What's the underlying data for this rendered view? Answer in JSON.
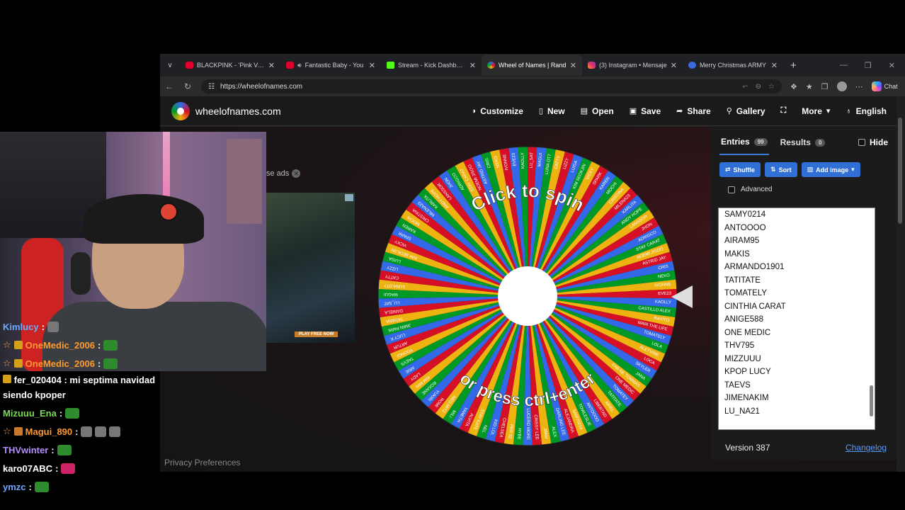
{
  "browser": {
    "tabs": [
      {
        "title": "BLACKPINK - 'Pink Vend",
        "icon": "youtube",
        "active": false
      },
      {
        "title": "Fantastic Baby - You",
        "icon": "youtube",
        "active": false
      },
      {
        "title": "Stream - Kick Dashboard",
        "icon": "kick",
        "active": false
      },
      {
        "title": "Wheel of Names | Rand",
        "icon": "wheelofnames",
        "active": true
      },
      {
        "title": "(3) Instagram • Mensaje",
        "icon": "instagram",
        "active": false
      },
      {
        "title": "Merry Christmas ARMY",
        "icon": "army",
        "active": false
      }
    ],
    "url": "https://wheelofnames.com",
    "chat_label": "Chat"
  },
  "site": {
    "brand": "wheelofnames.com",
    "menu": [
      {
        "label": "Customize",
        "icon": "palette-icon"
      },
      {
        "label": "New",
        "icon": "file-icon"
      },
      {
        "label": "Open",
        "icon": "folder-icon"
      },
      {
        "label": "Save",
        "icon": "save-icon"
      },
      {
        "label": "Share",
        "icon": "share-icon"
      },
      {
        "label": "Gallery",
        "icon": "search-icon"
      },
      {
        "label": "",
        "icon": "fullscreen-icon"
      },
      {
        "label": "More",
        "icon": "chevron-down-icon"
      },
      {
        "label": "English",
        "icon": "globe-icon"
      }
    ]
  },
  "ad": {
    "label": "se ads",
    "cta": "PLAY FREE NOW"
  },
  "privacy": "Privacy Preferences",
  "wheel": {
    "top_text": "Click to spin",
    "bottom_text": "or press ctrl+enter",
    "segment_colors": [
      "#d50f25",
      "#3369e8",
      "#009925",
      "#eeb211"
    ],
    "segment_count": 99,
    "labels": [
      "LU_SAT",
      "MAGUI",
      "LUNA OT7",
      "CATTY",
      "LIZZY",
      "LUISA",
      "KIM SEOKJIN",
      "VICKY",
      "SPARK",
      "KAREN",
      "MOCHI",
      "CRISTINA",
      "MILENA23",
      "KARLITA",
      "ANDY HOPE",
      "LANSSOR",
      "JHON",
      "ADRIGCO",
      "STAY CARAT",
      "NOEMI JISOO",
      "ASTRID JAY",
      "CRIS",
      "NEKO",
      "IVONNE",
      "EVE23",
      "KAOLLY",
      "CASTILLO ALEX",
      "RAYITO",
      "MARI THE LIFE",
      "TOMATELY",
      "LOLA",
      "ALETVINE",
      "LOCA",
      "SKYLER",
      "JANA",
      "FAB NE TOMMAS",
      "ONE MEDIC",
      "TOMATEY",
      "TATITATE",
      "ARIEL",
      "LIBERTAD",
      "ANTOOOO",
      "TOWLESLIE",
      "SAMY0214",
      "ALEJANDRA",
      "DARLING LEE",
      "ALEX",
      "JIMAI",
      "CRISSY LEE",
      "LUCERO MORE",
      "HYBE",
      "PER 02",
      "CHELSEA",
      "KIO LOL",
      "NEL",
      "STAY KATE",
      "ALVITA",
      "YANETH",
      "MILI",
      "NEO MITZ",
      "ROMI",
      "YUKIRI",
      "ROXANE",
      "KIM MIN",
      "LADY",
      "ARIE",
      "TAEVS",
      "YOONGI",
      "ARTUR",
      "LUCY K",
      "JIMIN PARK",
      "TATIANA",
      "DANIELA"
    ]
  },
  "panel": {
    "tabs": [
      {
        "label": "Entries",
        "count": "99",
        "active": true
      },
      {
        "label": "Results",
        "count": "0",
        "active": false
      }
    ],
    "hide_label": "Hide",
    "buttons": [
      {
        "label": "Shuffle",
        "icon": "shuffle-icon"
      },
      {
        "label": "Sort",
        "icon": "sort-icon"
      },
      {
        "label": "Add image",
        "icon": "image-icon"
      }
    ],
    "advanced_label": "Advanced",
    "entries": [
      "SAMY0214",
      "ANTOOOO",
      "AIRAM95",
      "MAKIS",
      "ARMANDO1901",
      "TATITATE",
      "TOMATELY",
      "CINTHIA CARAT",
      "ANIGE588",
      "ONE MEDIC",
      "THV795",
      "MIZZUUU",
      "KPOP LUCY",
      "TAEVS",
      "JIMENAKIM",
      "LU_NA21"
    ],
    "version": "Version 387",
    "changelog": "Changelog"
  },
  "chat": {
    "messages": [
      {
        "user": "Kimlucy",
        "text": "",
        "user_color": "blue",
        "emote": "gray",
        "badges": 0
      },
      {
        "user": "OneMedic_2006",
        "text": "",
        "user_color": "orange",
        "emote": "green",
        "badges": 2
      },
      {
        "user": "OneMedic_2006",
        "text": "",
        "user_color": "orange",
        "emote": "green",
        "badges": 2
      },
      {
        "user": "fer_020404",
        "text": "mi septima navidad siendo kpoper",
        "user_color": "white",
        "emote": "",
        "badges": 1
      },
      {
        "user": "Mizuuu_Ena",
        "text": "",
        "user_color": "green",
        "emote": "green",
        "badges": 0
      },
      {
        "user": "Magui_890",
        "text": "",
        "user_color": "orange",
        "emote": "gray3",
        "badges": 2
      },
      {
        "user": "THVwinter",
        "text": "",
        "user_color": "purple",
        "emote": "green",
        "badges": 0
      },
      {
        "user": "karo07ABC",
        "text": "",
        "user_color": "white",
        "emote": "pink",
        "badges": 0
      },
      {
        "user": "ymzc",
        "text": "",
        "user_color": "blue",
        "emote": "green",
        "badges": 0
      }
    ]
  }
}
